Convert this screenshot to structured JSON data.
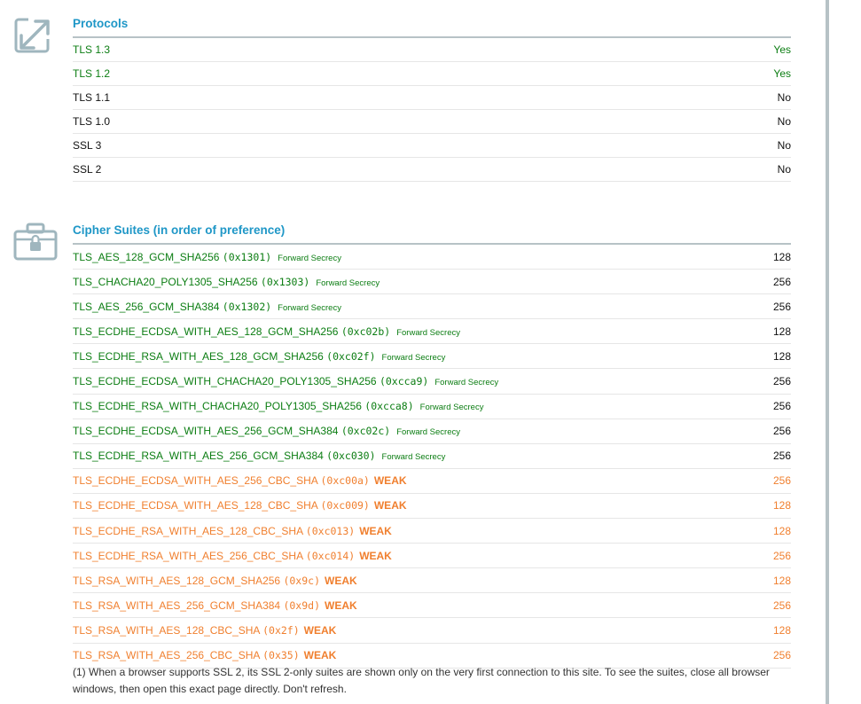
{
  "protocols": {
    "title": "Protocols",
    "rows": [
      {
        "name": "TLS 1.3",
        "value": "Yes",
        "status": "green"
      },
      {
        "name": "TLS 1.2",
        "value": "Yes",
        "status": "green"
      },
      {
        "name": "TLS 1.1",
        "value": "No",
        "status": "black"
      },
      {
        "name": "TLS 1.0",
        "value": "No",
        "status": "black"
      },
      {
        "name": "SSL 3",
        "value": "No",
        "status": "black"
      },
      {
        "name": "SSL 2",
        "value": "No",
        "status": "black"
      }
    ]
  },
  "ciphers": {
    "title": "Cipher Suites (in order of preference)",
    "rows": [
      {
        "name": "TLS_AES_128_GCM_SHA256",
        "code": "(0x1301)",
        "tag": "Forward Secrecy",
        "bits": "128",
        "status": "green"
      },
      {
        "name": "TLS_CHACHA20_POLY1305_SHA256",
        "code": "(0x1303)",
        "tag": "Forward Secrecy",
        "bits": "256",
        "status": "green"
      },
      {
        "name": "TLS_AES_256_GCM_SHA384",
        "code": "(0x1302)",
        "tag": "Forward Secrecy",
        "bits": "256",
        "status": "green"
      },
      {
        "name": "TLS_ECDHE_ECDSA_WITH_AES_128_GCM_SHA256",
        "code": "(0xc02b)",
        "tag": "Forward Secrecy",
        "bits": "128",
        "status": "green"
      },
      {
        "name": "TLS_ECDHE_RSA_WITH_AES_128_GCM_SHA256",
        "code": "(0xc02f)",
        "tag": "Forward Secrecy",
        "bits": "128",
        "status": "green"
      },
      {
        "name": "TLS_ECDHE_ECDSA_WITH_CHACHA20_POLY1305_SHA256",
        "code": "(0xcca9)",
        "tag": "Forward Secrecy",
        "bits": "256",
        "status": "green"
      },
      {
        "name": "TLS_ECDHE_RSA_WITH_CHACHA20_POLY1305_SHA256",
        "code": "(0xcca8)",
        "tag": "Forward Secrecy",
        "bits": "256",
        "status": "green"
      },
      {
        "name": "TLS_ECDHE_ECDSA_WITH_AES_256_GCM_SHA384",
        "code": "(0xc02c)",
        "tag": "Forward Secrecy",
        "bits": "256",
        "status": "green"
      },
      {
        "name": "TLS_ECDHE_RSA_WITH_AES_256_GCM_SHA384",
        "code": "(0xc030)",
        "tag": "Forward Secrecy",
        "bits": "256",
        "status": "green"
      },
      {
        "name": "TLS_ECDHE_ECDSA_WITH_AES_256_CBC_SHA",
        "code": "(0xc00a)",
        "tag": "WEAK",
        "bits": "256",
        "status": "orange"
      },
      {
        "name": "TLS_ECDHE_ECDSA_WITH_AES_128_CBC_SHA",
        "code": "(0xc009)",
        "tag": "WEAK",
        "bits": "128",
        "status": "orange"
      },
      {
        "name": "TLS_ECDHE_RSA_WITH_AES_128_CBC_SHA",
        "code": "(0xc013)",
        "tag": "WEAK",
        "bits": "128",
        "status": "orange"
      },
      {
        "name": "TLS_ECDHE_RSA_WITH_AES_256_CBC_SHA",
        "code": "(0xc014)",
        "tag": "WEAK",
        "bits": "256",
        "status": "orange"
      },
      {
        "name": "TLS_RSA_WITH_AES_128_GCM_SHA256",
        "code": "(0x9c)",
        "tag": "WEAK",
        "bits": "128",
        "status": "orange"
      },
      {
        "name": "TLS_RSA_WITH_AES_256_GCM_SHA384",
        "code": "(0x9d)",
        "tag": "WEAK",
        "bits": "256",
        "status": "orange"
      },
      {
        "name": "TLS_RSA_WITH_AES_128_CBC_SHA",
        "code": "(0x2f)",
        "tag": "WEAK",
        "bits": "128",
        "status": "orange"
      },
      {
        "name": "TLS_RSA_WITH_AES_256_CBC_SHA",
        "code": "(0x35)",
        "tag": "WEAK",
        "bits": "256",
        "status": "orange"
      }
    ]
  },
  "footnote": "(1) When a browser supports SSL 2, its SSL 2-only suites are shown only on the very first connection to this site. To see the suites, close all browser windows, then open this exact page directly. Don't refresh.",
  "icons": {
    "protocols": "expand-arrows-icon",
    "ciphers": "lock-briefcase-icon"
  },
  "colors": {
    "accent": "#1f97c7",
    "good": "#0b7d12",
    "weak": "#f07f2e",
    "icon": "#9fb6be"
  }
}
